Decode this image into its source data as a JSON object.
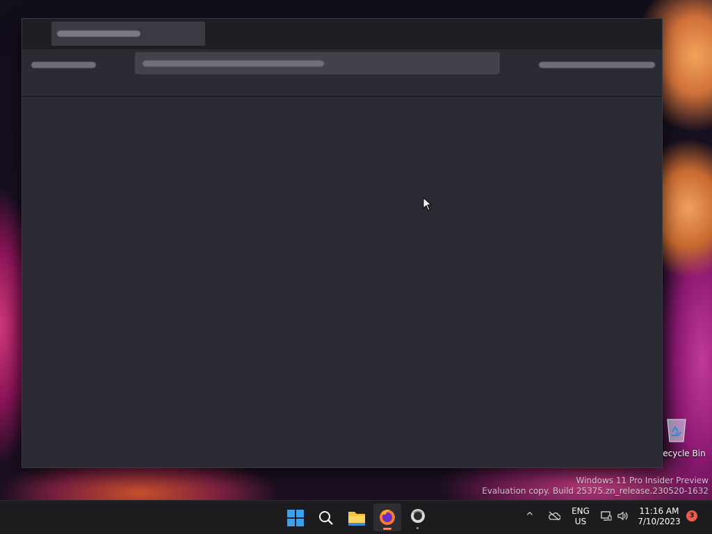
{
  "desktop": {
    "recycle_bin_label": "ecycle Bin",
    "watermark": {
      "line1": "Windows 11 Pro Insider Preview",
      "line2": "Evaluation copy. Build 25375.zn_release.230520-1632"
    }
  },
  "browser": {
    "state": "loading placeholders",
    "tab_title": "",
    "url": ""
  },
  "taskbar": {
    "pinned": [
      {
        "name": "start-icon"
      },
      {
        "name": "search-icon"
      },
      {
        "name": "file-explorer-icon"
      },
      {
        "name": "firefox-icon",
        "active": true
      },
      {
        "name": "app-icon"
      }
    ],
    "tray": {
      "chevron": "^",
      "lang_line1": "ENG",
      "lang_line2": "US",
      "time": "11:16 AM",
      "date": "7/10/2023",
      "notification_count": "3"
    }
  },
  "colors": {
    "window_bg": "#27272f",
    "taskbar_bg": "#1c1c1f",
    "badge": "#f25a4a"
  }
}
